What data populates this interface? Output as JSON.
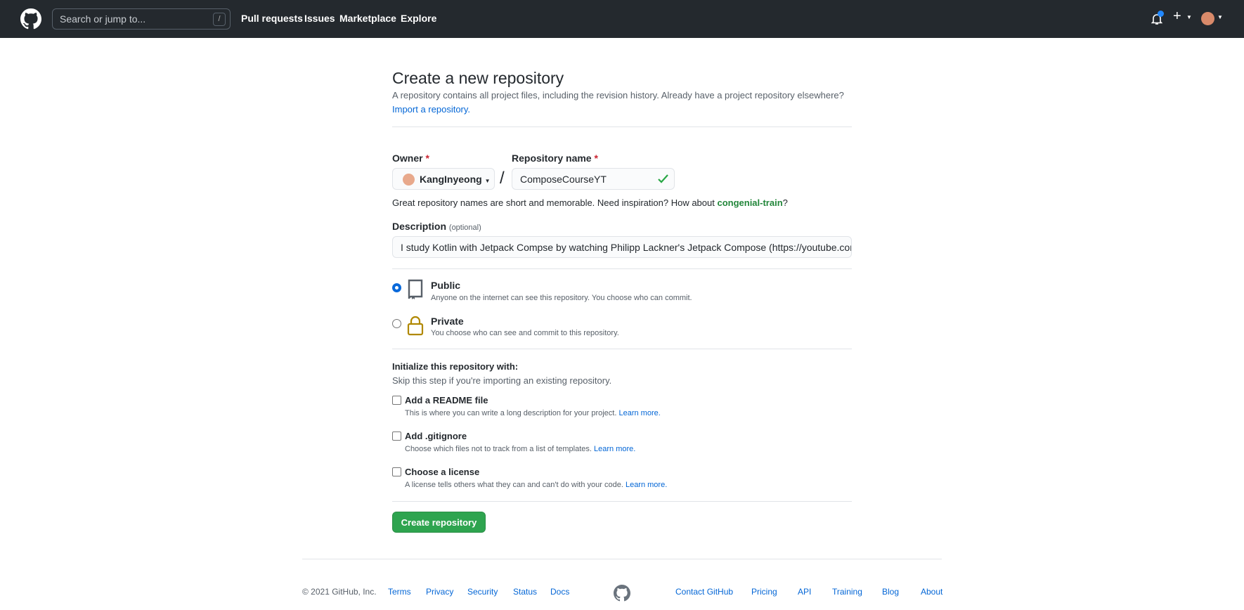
{
  "header": {
    "search_placeholder": "Search or jump to...",
    "search_key": "/",
    "nav": [
      "Pull requests",
      "Issues",
      "Marketplace",
      "Explore"
    ],
    "notification_dot_color": "#2188ff"
  },
  "page": {
    "title": "Create a new repository",
    "subtitle": "A repository contains all project files, including the revision history. Already have a project repository elsewhere?",
    "import_link": "Import a repository."
  },
  "form": {
    "owner_label": "Owner",
    "required_mark": "*",
    "owner_value": "KangInyeong",
    "separator": "/",
    "repo_label": "Repository name",
    "repo_value": "ComposeCourseYT",
    "hint_prefix": "Great repository names are short and memorable. Need inspiration? How about ",
    "hint_suggestion": "congenial-train",
    "hint_suffix": "?",
    "description_label": "Description",
    "description_optional": "(optional)",
    "description_value": "I study Kotlin with Jetpack Compse by watching  Philipp Lackner's Jetpack Compose (https://youtube.com/playlist",
    "visibility": [
      {
        "title": "Public",
        "desc": "Anyone on the internet can see this repository. You choose who can commit.",
        "checked": true
      },
      {
        "title": "Private",
        "desc": "You choose who can see and commit to this repository.",
        "checked": false
      }
    ],
    "init_title": "Initialize this repository with:",
    "init_subtitle": "Skip this step if you're importing an existing repository.",
    "init_options": [
      {
        "title": "Add a README file",
        "desc": "This is where you can write a long description for your project.",
        "link": "Learn more."
      },
      {
        "title": "Add .gitignore",
        "desc": "Choose which files not to track from a list of templates.",
        "link": "Learn more."
      },
      {
        "title": "Choose a license",
        "desc": "A license tells others what they can and can't do with your code.",
        "link": "Learn more."
      }
    ],
    "submit": "Create repository"
  },
  "footer": {
    "copyright": "© 2021 GitHub, Inc.",
    "left_links": [
      "Terms",
      "Privacy",
      "Security",
      "Status",
      "Docs"
    ],
    "right_links": [
      "Contact GitHub",
      "Pricing",
      "API",
      "Training",
      "Blog",
      "About"
    ]
  }
}
